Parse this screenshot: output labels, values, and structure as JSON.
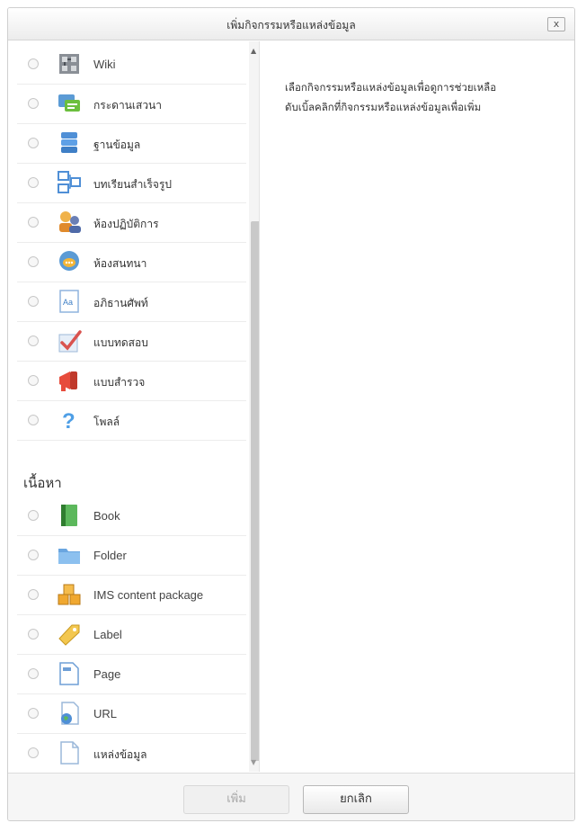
{
  "dialog": {
    "title": "เพิ่มกิจกรรมหรือแหล่งข้อมูล",
    "close": "x"
  },
  "activities": [
    {
      "label": "Wiki",
      "icon": "wiki-icon"
    },
    {
      "label": "กระดานเสวนา",
      "icon": "forum-icon"
    },
    {
      "label": "ฐานข้อมูล",
      "icon": "database-icon"
    },
    {
      "label": "บทเรียนสำเร็จรูป",
      "icon": "lesson-icon"
    },
    {
      "label": "ห้องปฏิบัติการ",
      "icon": "workshop-icon"
    },
    {
      "label": "ห้องสนทนา",
      "icon": "chat-icon"
    },
    {
      "label": "อภิธานศัพท์",
      "icon": "glossary-icon"
    },
    {
      "label": "แบบทดสอบ",
      "icon": "quiz-icon"
    },
    {
      "label": "แบบสำรวจ",
      "icon": "survey-icon"
    },
    {
      "label": "โพลล์",
      "icon": "choice-icon"
    }
  ],
  "resources_heading": "เนื้อหา",
  "resources": [
    {
      "label": "Book",
      "icon": "book-icon"
    },
    {
      "label": "Folder",
      "icon": "folder-icon"
    },
    {
      "label": "IMS content package",
      "icon": "ims-package-icon"
    },
    {
      "label": "Label",
      "icon": "label-icon"
    },
    {
      "label": "Page",
      "icon": "page-icon"
    },
    {
      "label": "URL",
      "icon": "url-icon"
    },
    {
      "label": "แหล่งข้อมูล",
      "icon": "file-icon"
    }
  ],
  "help": {
    "line1": "เลือกกิจกรรมหรือแหล่งข้อมูลเพื่อดูการช่วยเหลือ",
    "line2": "ดับเบิ้ลคลิกที่กิจกรรมหรือแหล่งข้อมูลเพื่อเพิ่ม"
  },
  "footer": {
    "add_label": "เพิ่ม",
    "cancel_label": "ยกเลิก"
  }
}
